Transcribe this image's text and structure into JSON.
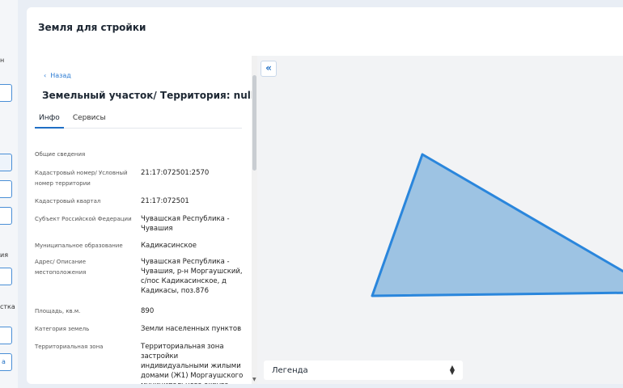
{
  "page": {
    "title": "Земля для стройки"
  },
  "rail": {
    "labels": [
      "н",
      "ия",
      "стка",
      "а"
    ]
  },
  "panel": {
    "back_label": "Назад",
    "heading": "Земельный участок/ Территория: null",
    "tabs": [
      {
        "label": "Инфо",
        "active": true
      },
      {
        "label": "Сервисы",
        "active": false
      }
    ],
    "section_title": "Общие сведения",
    "fields": [
      {
        "label": "Кадастровый номер/ Условный номер территории",
        "value": "21:17:072501:2570"
      },
      {
        "label": "Кадастровый квартал",
        "value": "21:17:072501"
      },
      {
        "label": "Субъект Российской Федерации",
        "value": "Чувашская Республика - Чувашия"
      },
      {
        "label": "Муниципальное образование",
        "value": "Кадикасинское"
      },
      {
        "label": "Адрес/ Описание местоположения",
        "value": "Чувашская Республика - Чувашия, р-н Моргаушский, с/пос Кадикасинское, д Кадикасы, поз.876"
      },
      {
        "label": "Площадь, кв.м.",
        "value": "890"
      },
      {
        "label": "Категория земель",
        "value": "Земли населенных пунктов"
      },
      {
        "label": "Территориальная зона",
        "value": "Территориальная зона застройки индивидуальными жилыми домами (Ж1) Моргаушского муниципального округа"
      }
    ]
  },
  "map": {
    "collapse_icon": "«",
    "legend_label": "Легенда",
    "polygon_fill": "#9dc3e3",
    "polygon_stroke": "#2a86dc"
  },
  "colors": {
    "accent": "#1f6fc5",
    "background": "#e9eef5"
  }
}
